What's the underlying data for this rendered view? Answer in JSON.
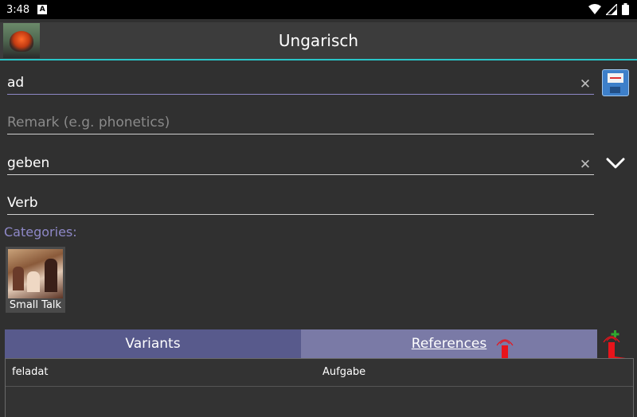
{
  "status_bar": {
    "time": "3:48",
    "notification_icon": "A"
  },
  "app_bar": {
    "title": "Ungarisch"
  },
  "form": {
    "word": {
      "value": "ad"
    },
    "remark": {
      "placeholder": "Remark (e.g. phonetics)"
    },
    "translation": {
      "value": "geben"
    },
    "word_type": {
      "value": "Verb"
    }
  },
  "categories": {
    "label": "Categories:",
    "items": [
      {
        "name": "Small Talk"
      }
    ]
  },
  "tabs": [
    {
      "label": "Variants"
    },
    {
      "label": "References"
    }
  ],
  "references_table": {
    "rows": [
      {
        "source": "feladat",
        "target": "Aufgabe"
      }
    ]
  },
  "colors": {
    "accent": "#29c5c8",
    "tab_variants": "#585a8c",
    "tab_references": "#7a7aa6",
    "label_purple": "#8e88c7"
  },
  "icons": [
    "wifi-icon",
    "signal-icon",
    "battery-icon",
    "clear-icon",
    "save-icon",
    "chevron-down-icon",
    "hand-pointer-icon",
    "add-icon"
  ]
}
